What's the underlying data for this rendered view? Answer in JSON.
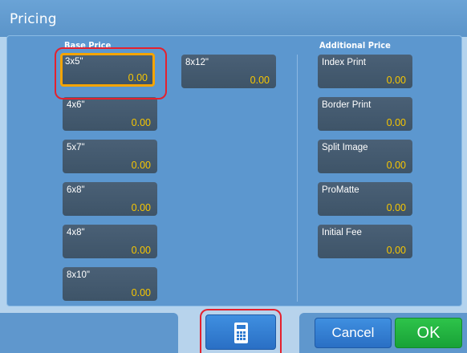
{
  "window": {
    "title": "Pricing"
  },
  "base_price": {
    "label": "Base Price",
    "items": [
      {
        "label": "3x5\"",
        "value": "0.00",
        "selected": true
      },
      {
        "label": "4x6\"",
        "value": "0.00"
      },
      {
        "label": "5x7\"",
        "value": "0.00"
      },
      {
        "label": "6x8\"",
        "value": "0.00"
      },
      {
        "label": "4x8\"",
        "value": "0.00"
      },
      {
        "label": "8x10\"",
        "value": "0.00"
      },
      {
        "label": "8x12\"",
        "value": "0.00"
      }
    ]
  },
  "additional_price": {
    "label": "Additional Price",
    "items": [
      {
        "label": "Index Print",
        "value": "0.00"
      },
      {
        "label": "Border Print",
        "value": "0.00"
      },
      {
        "label": "Split Image",
        "value": "0.00"
      },
      {
        "label": "ProMatte",
        "value": "0.00"
      },
      {
        "label": "Initial Fee",
        "value": "0.00"
      }
    ]
  },
  "footer": {
    "calculator_icon": "calculator-icon",
    "cancel_label": "Cancel",
    "ok_label": "OK"
  },
  "colors": {
    "value_text": "#f7c600",
    "selected_border": "#f5a400",
    "highlight_ring": "#e4212e",
    "ok_button": "#18a237",
    "blue_button": "#2a6fc4"
  }
}
